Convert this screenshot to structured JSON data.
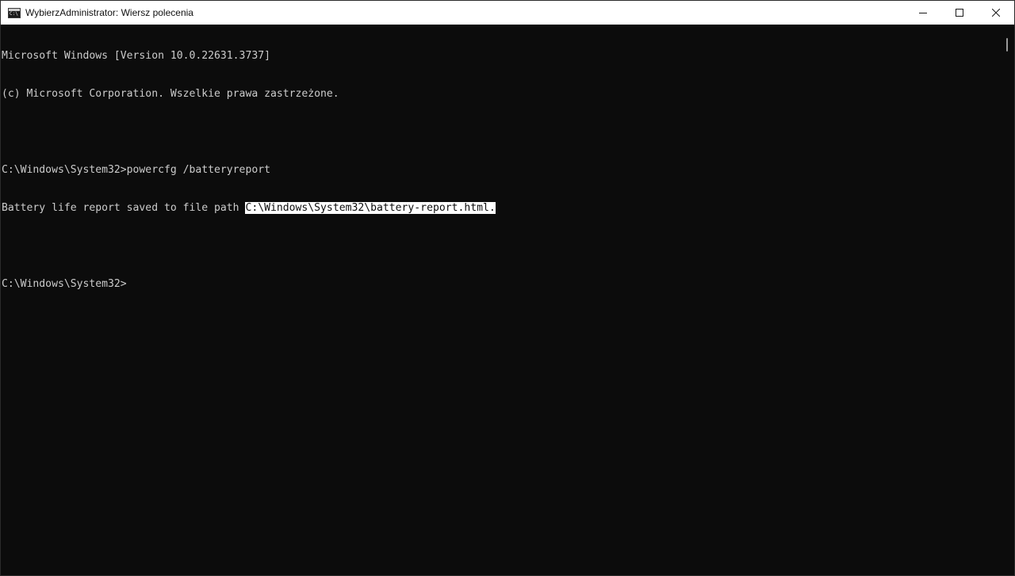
{
  "window": {
    "title": "WybierzAdministrator: Wiersz polecenia",
    "icon": "cmd-icon",
    "icon_glyph": "C:\\"
  },
  "controls": {
    "minimize": "minimize-icon",
    "maximize": "maximize-icon",
    "close": "close-icon"
  },
  "console": {
    "lines": [
      "Microsoft Windows [Version 10.0.22631.3737]",
      "(c) Microsoft Corporation. Wszelkie prawa zastrzeżone.",
      "",
      "C:\\Windows\\System32>powercfg /batteryreport",
      "Battery life report saved to file path ",
      "",
      "C:\\Windows\\System32>"
    ],
    "selected_path": "C:\\Windows\\System32\\battery-report.html."
  },
  "colors": {
    "console_background": "#0c0c0c",
    "console_text": "#cccccc",
    "titlebar_background": "#ffffff",
    "selection_background": "#ffffff"
  }
}
